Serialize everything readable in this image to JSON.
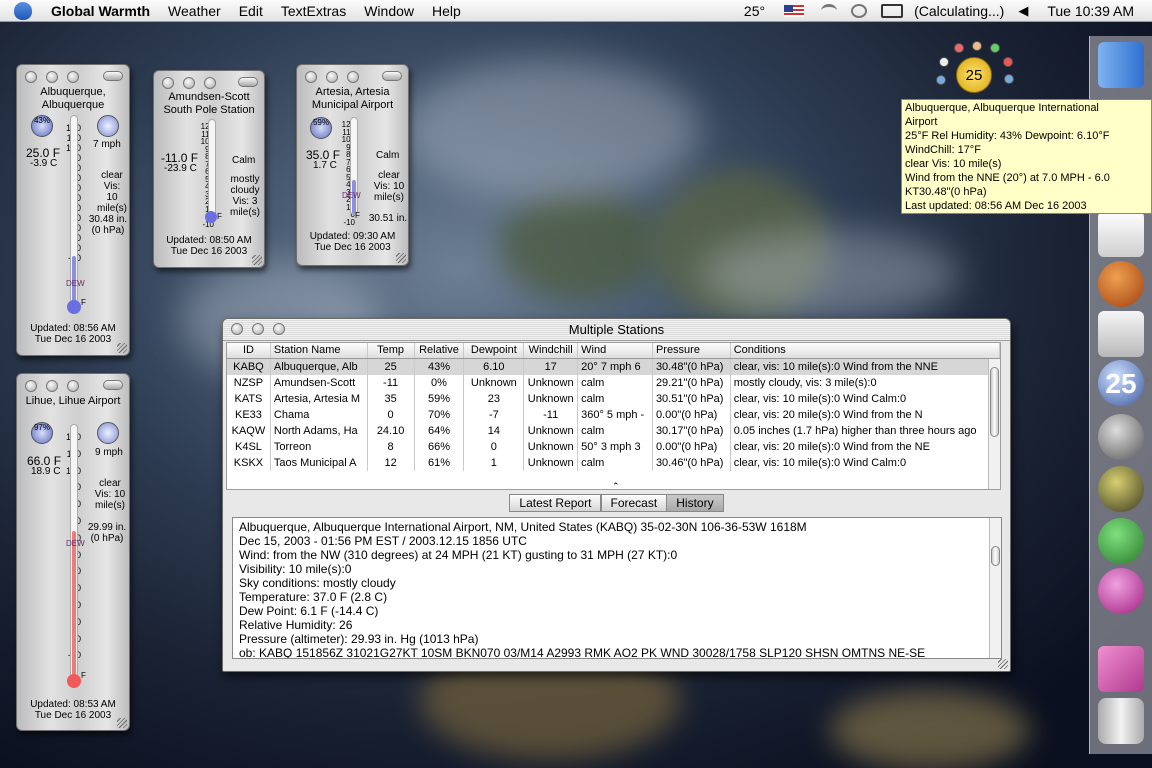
{
  "menubar": {
    "app_name": "Global Warmth",
    "menus": [
      "Weather",
      "Edit",
      "TextExtras",
      "Window",
      "Help"
    ],
    "temp": "25°",
    "status": "(Calculating...)",
    "clock": "Tue 10:39 AM"
  },
  "menulet": {
    "temp": "25"
  },
  "tooltip": {
    "lines": [
      "Albuquerque, Albuquerque International",
      "Airport",
      "25°F   Rel Humidity: 43%   Dewpoint: 6.10°F",
      "WindChill: 17°F",
      "clear  Vis: 10 mile(s)",
      "Wind from the NNE (20°) at 7.0 MPH - 6.0",
      "KT30.48\"(0 hPa)",
      "Last updated: 08:56 AM  Dec 16 2003"
    ]
  },
  "widgets": {
    "abq": {
      "title1": "Albuquerque,",
      "title2": "Albuquerque",
      "humidity": "43%",
      "temp_f": "25.0 F",
      "temp_c": "-3.9 C",
      "wind": "7 mph",
      "cond1": "clear",
      "cond2": "Vis: 10",
      "cond3": "mile(s)",
      "press1": "30.48 in.",
      "press2": "(0 hPa)",
      "updated": "Updated: 08:56 AM",
      "date": "Tue Dec 16 2003",
      "scale": [
        "120",
        "110",
        "100",
        "90",
        "80",
        "70",
        "60",
        "50",
        "40",
        "30",
        "20",
        "10",
        "0",
        "-10"
      ],
      "dew": "DEW",
      "unit": "F",
      "level": 0.25
    },
    "nzsp": {
      "title1": "Amundsen-Scott",
      "title2": "South Pole Station",
      "temp_f": "-11.0 F",
      "temp_c": "-23.9 C",
      "wind": "Calm",
      "cond1": "mostly",
      "cond2": "cloudy",
      "cond3": "Vis: 3",
      "cond4": "mile(s)",
      "updated": "Updated: 08:50 AM",
      "date": "Tue Dec 16 2003",
      "scale": [
        "120",
        "110",
        "100",
        "90",
        "80",
        "70",
        "60",
        "50",
        "40",
        "30",
        "20",
        "10",
        "0",
        "-10"
      ],
      "unit": "F",
      "level": 0.0
    },
    "kats": {
      "title1": "Artesia, Artesia",
      "title2": "Municipal Airport",
      "humidity": "59%",
      "temp_f": "35.0 F",
      "temp_c": "1.7 C",
      "wind": "Calm",
      "cond1": "clear",
      "cond2": "Vis: 10",
      "cond3": "mile(s)",
      "press1": "30.51 in.",
      "updated": "Updated: 09:30 AM",
      "date": "Tue Dec 16 2003",
      "scale": [
        "120",
        "110",
        "100",
        "90",
        "80",
        "70",
        "60",
        "50",
        "40",
        "30",
        "20",
        "10",
        "0",
        "-10"
      ],
      "dew": "DEW",
      "unit": "F",
      "level": 0.35
    },
    "lihue": {
      "title1": "Lihue, Lihue Airport",
      "humidity": "97%",
      "temp_f": "66.0 F",
      "temp_c": "18.9 C",
      "wind": "9 mph",
      "cond1": "clear",
      "cond2": "Vis: 10",
      "cond3": "mile(s)",
      "press1": "29.99 in.",
      "press2": "(0 hPa)",
      "updated": "Updated: 08:53 AM",
      "date": "Tue Dec 16 2003",
      "scale": [
        "120",
        "110",
        "100",
        "90",
        "80",
        "70",
        "60",
        "50",
        "40",
        "30",
        "20",
        "10",
        "0",
        "-10"
      ],
      "dew": "DEW",
      "unit": "F",
      "level": 0.58
    }
  },
  "main": {
    "title": "Multiple Stations",
    "columns": [
      "ID",
      "Station Name",
      "Temp",
      "Relative",
      "Dewpoint",
      "Windchill",
      "Wind",
      "Pressure",
      "Conditions"
    ],
    "rows": [
      [
        "KABQ",
        "Albuquerque, Alb",
        "25",
        "43%",
        "6.10",
        "17",
        "20° 7 mph 6",
        "30.48\"(0 hPa)",
        "clear, vis: 10 mile(s):0 Wind from the NNE"
      ],
      [
        "NZSP",
        "Amundsen-Scott",
        "-11",
        "0%",
        "Unknown",
        "Unknown",
        "calm",
        "29.21\"(0 hPa)",
        "mostly cloudy, vis: 3 mile(s):0"
      ],
      [
        "KATS",
        "Artesia, Artesia M",
        "35",
        "59%",
        "23",
        "Unknown",
        "calm",
        "30.51\"(0 hPa)",
        "clear, vis: 10 mile(s):0 Wind Calm:0"
      ],
      [
        "KE33",
        "Chama",
        "0",
        "70%",
        "-7",
        "-11",
        "360° 5 mph -",
        "0.00\"(0 hPa)",
        "clear, vis: 20 mile(s):0 Wind from the N"
      ],
      [
        "KAQW",
        "North Adams, Ha",
        "24.10",
        "64%",
        "14",
        "Unknown",
        "calm",
        "30.17\"(0 hPa)",
        "0.05 inches (1.7 hPa) higher than three hours ago"
      ],
      [
        "K4SL",
        "Torreon",
        "8",
        "66%",
        "0",
        "Unknown",
        "50° 3 mph 3",
        "0.00\"(0 hPa)",
        "clear, vis: 20 mile(s):0 Wind from the NE"
      ],
      [
        "KSKX",
        "Taos Municipal A",
        "12",
        "61%",
        "1",
        "Unknown",
        "calm",
        "30.46\"(0 hPa)",
        "clear, vis: 10 mile(s):0 Wind Calm:0"
      ]
    ],
    "tabs": [
      "Latest Report",
      "Forecast",
      "History"
    ],
    "report": [
      "Albuquerque, Albuquerque International Airport, NM, United States (KABQ) 35-02-30N 106-36-53W 1618M",
      "Dec 15, 2003 - 01:56 PM EST / 2003.12.15 1856 UTC",
      "Wind: from the NW (310 degrees) at 24 MPH (21 KT) gusting to 31 MPH (27 KT):0",
      "Visibility: 10 mile(s):0",
      "Sky conditions: mostly cloudy",
      "Temperature: 37.0 F (2.8 C)",
      "Dew Point: 6.1 F (-14.4 C)",
      "Relative Humidity: 26",
      "Pressure (altimeter): 29.93 in. Hg (1013 hPa)",
      "ob: KABQ 151856Z 31021G27KT 10SM BKN070 03/M14 A2993 RMK AO2 PK WND 30028/1758 SLP120 SHSN OMTNS NE-SE"
    ]
  },
  "dock": {
    "badge": "25"
  }
}
